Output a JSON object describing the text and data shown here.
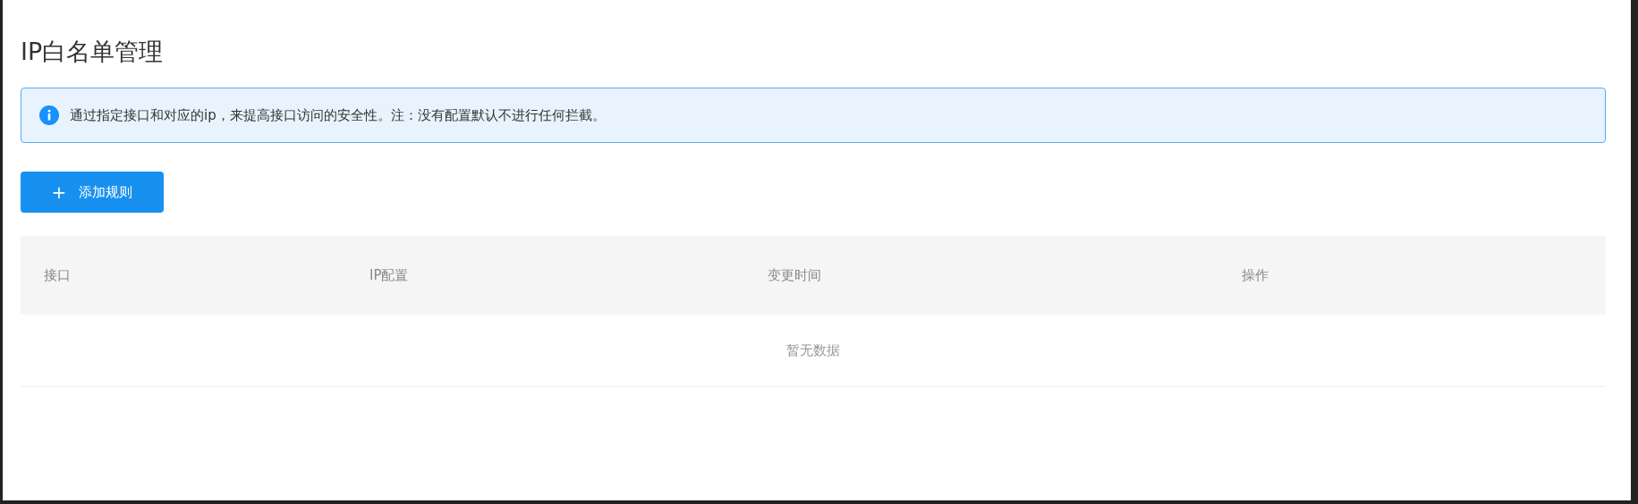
{
  "page": {
    "title": "IP白名单管理"
  },
  "alert": {
    "text": "通过指定接口和对应的ip，来提高接口访问的安全性。注：没有配置默认不进行任何拦截。"
  },
  "add_button": {
    "icon": "+",
    "label": "添加规则"
  },
  "table": {
    "columns": [
      "接口",
      "IP配置",
      "变更时间",
      "操作"
    ],
    "empty_text": "暂无数据"
  }
}
